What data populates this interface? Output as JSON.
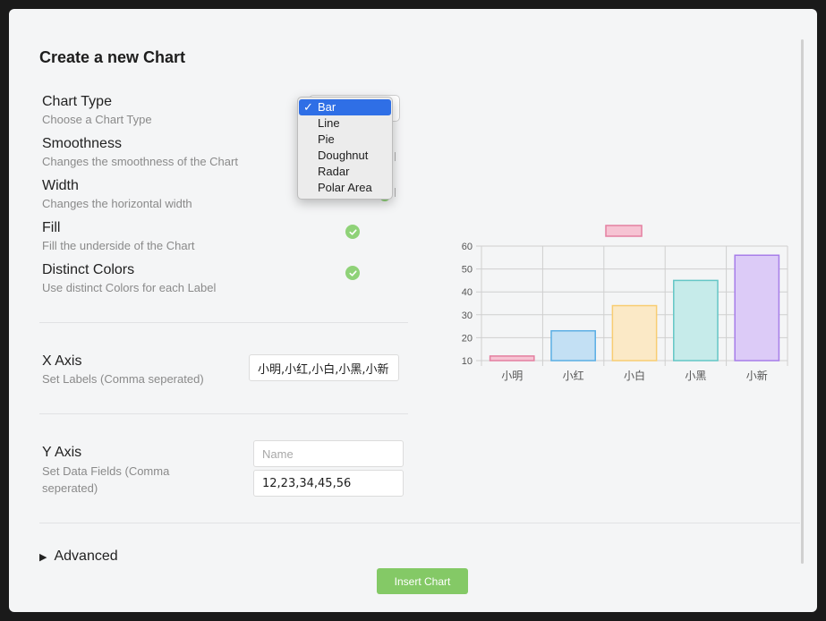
{
  "dialog": {
    "title": "Create a new Chart"
  },
  "settings": {
    "chart_type": {
      "label": "Chart Type",
      "desc": "Choose a Chart Type"
    },
    "smoothness": {
      "label": "Smoothness",
      "desc": "Changes the smoothness of the Chart"
    },
    "width": {
      "label": "Width",
      "desc": "Changes the horizontal width"
    },
    "fill": {
      "label": "Fill",
      "desc": "Fill the underside of the Chart",
      "checked": true
    },
    "distinct": {
      "label": "Distinct Colors",
      "desc": "Use distinct Colors for each Label",
      "checked": true
    }
  },
  "dropdown": {
    "options": [
      "Bar",
      "Line",
      "Pie",
      "Doughnut",
      "Radar",
      "Polar Area"
    ],
    "selected": "Bar",
    "check_mark": "✓"
  },
  "x_axis": {
    "label": "X Axis",
    "desc": "Set Labels (Comma seperated)",
    "value": "小明,小红,小白,小黑,小新"
  },
  "y_axis": {
    "label": "Y Axis",
    "desc": "Set Data Fields (Comma seperated)",
    "name_placeholder": "Name",
    "value": "12,23,34,45,56"
  },
  "advanced": {
    "label": "Advanced",
    "arrow_icon": "▶"
  },
  "insert_button": {
    "label": "Insert Chart"
  },
  "colors": {
    "accent": "#84c966",
    "check": "#8fd278",
    "selection": "#2f6fe6"
  },
  "chart_data": {
    "type": "bar",
    "categories": [
      "小明",
      "小红",
      "小白",
      "小黑",
      "小新"
    ],
    "values": [
      12,
      23,
      34,
      45,
      56
    ],
    "ylim": [
      10,
      60
    ],
    "yticks": [
      10,
      20,
      30,
      40,
      50,
      60
    ],
    "grid": true,
    "legend": "top",
    "fill_colors": [
      "#f6c3d3",
      "#c3e0f4",
      "#fbe9c6",
      "#c6ebea",
      "#dccbf7"
    ],
    "stroke_colors": [
      "#e47fa0",
      "#5aaee4",
      "#f8cd72",
      "#64c6c6",
      "#a77de9"
    ]
  }
}
